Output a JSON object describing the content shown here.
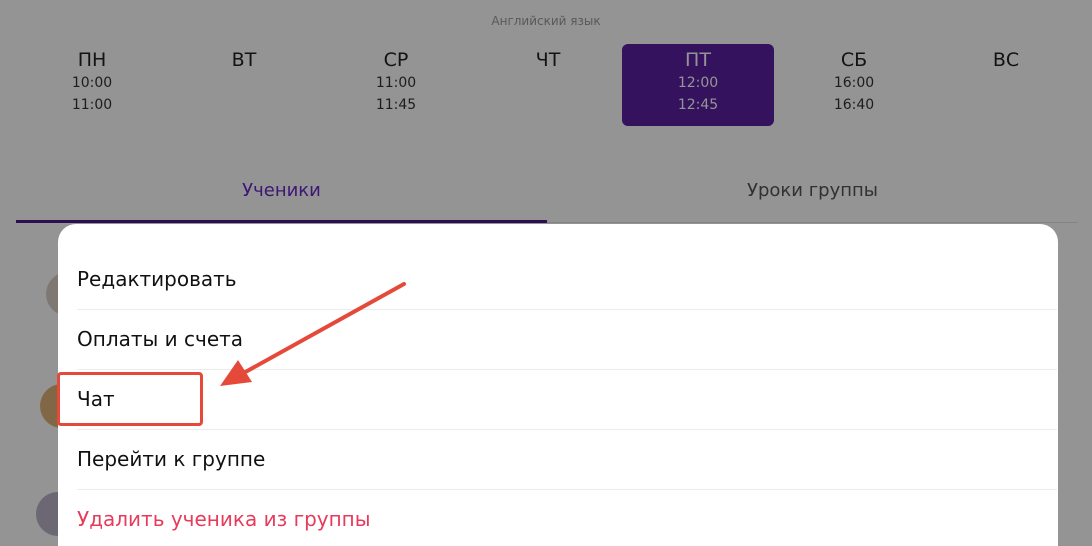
{
  "schedule": {
    "subject": "Английский язык",
    "days": [
      {
        "name": "ПН",
        "times": [
          "10:00",
          "11:00"
        ],
        "selected": false
      },
      {
        "name": "ВТ",
        "times": [],
        "selected": false
      },
      {
        "name": "СР",
        "times": [
          "11:00",
          "11:45"
        ],
        "selected": false
      },
      {
        "name": "ЧТ",
        "times": [],
        "selected": false
      },
      {
        "name": "ПТ",
        "times": [
          "12:00",
          "12:45"
        ],
        "selected": true
      },
      {
        "name": "СБ",
        "times": [
          "16:00",
          "16:40"
        ],
        "selected": false
      },
      {
        "name": "ВС",
        "times": [],
        "selected": false
      }
    ]
  },
  "tabs": {
    "students": "Ученики",
    "lessons": "Уроки группы",
    "active": "students"
  },
  "menu": {
    "edit": "Редактировать",
    "payments": "Оплаты и счета",
    "chat": "Чат",
    "go_to_group": "Перейти к группе",
    "remove_student": "Удалить ученика из группы"
  },
  "colors": {
    "accent": "#5a1fa3",
    "danger": "#e83a5a",
    "annotation": "#e5493a"
  }
}
